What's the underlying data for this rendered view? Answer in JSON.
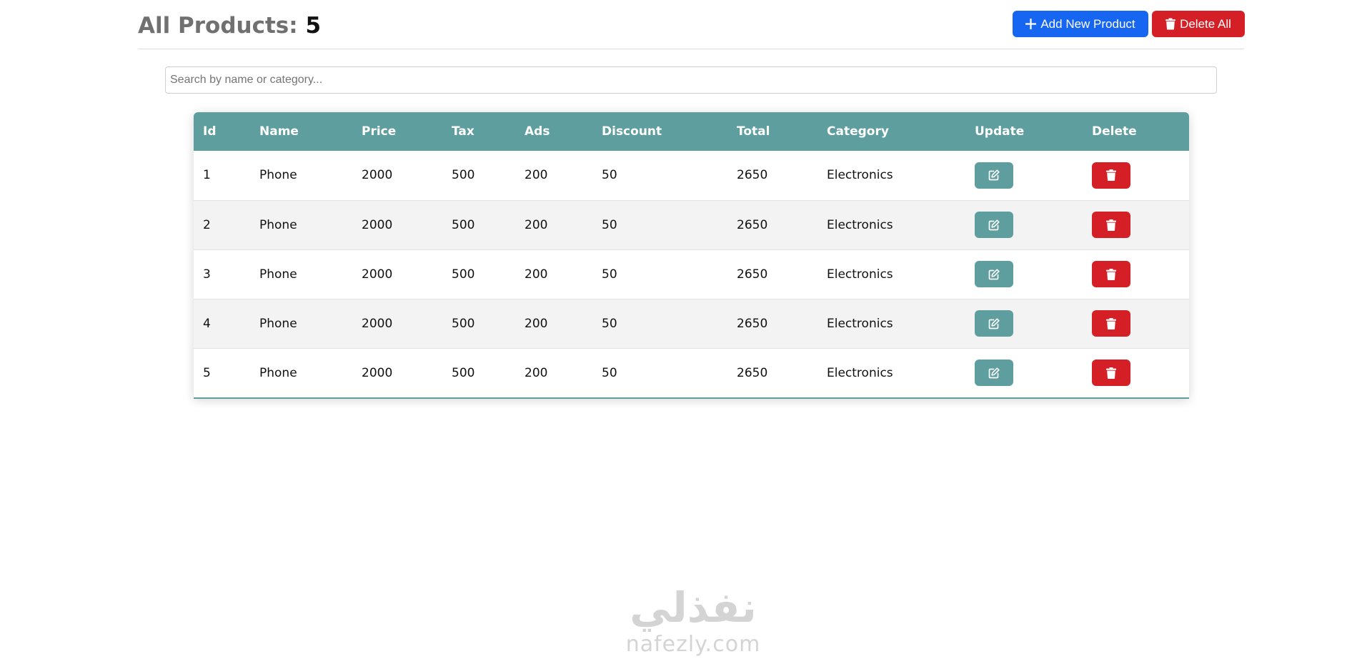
{
  "header": {
    "title_label": "All Products:",
    "product_count": "5",
    "add_button_label": "Add New Product",
    "delete_all_button_label": "Delete All"
  },
  "search": {
    "placeholder": "Search by name or category...",
    "value": ""
  },
  "table": {
    "columns": [
      "Id",
      "Name",
      "Price",
      "Tax",
      "Ads",
      "Discount",
      "Total",
      "Category",
      "Update",
      "Delete"
    ],
    "rows": [
      {
        "id": "1",
        "name": "Phone",
        "price": "2000",
        "tax": "500",
        "ads": "200",
        "discount": "50",
        "total": "2650",
        "category": "Electronics"
      },
      {
        "id": "2",
        "name": "Phone",
        "price": "2000",
        "tax": "500",
        "ads": "200",
        "discount": "50",
        "total": "2650",
        "category": "Electronics"
      },
      {
        "id": "3",
        "name": "Phone",
        "price": "2000",
        "tax": "500",
        "ads": "200",
        "discount": "50",
        "total": "2650",
        "category": "Electronics"
      },
      {
        "id": "4",
        "name": "Phone",
        "price": "2000",
        "tax": "500",
        "ads": "200",
        "discount": "50",
        "total": "2650",
        "category": "Electronics"
      },
      {
        "id": "5",
        "name": "Phone",
        "price": "2000",
        "tax": "500",
        "ads": "200",
        "discount": "50",
        "total": "2650",
        "category": "Electronics"
      }
    ]
  },
  "watermark": {
    "arabic_text": "نفذلي",
    "latin_text": "nafezly.com"
  },
  "colors": {
    "primary_blue": "#1766f2",
    "danger_red": "#d41f26",
    "teal_header": "#5f9e9e"
  },
  "icons": {
    "add": "plus-icon",
    "delete_all": "trash-icon",
    "update": "edit-icon",
    "delete": "trash-icon"
  }
}
